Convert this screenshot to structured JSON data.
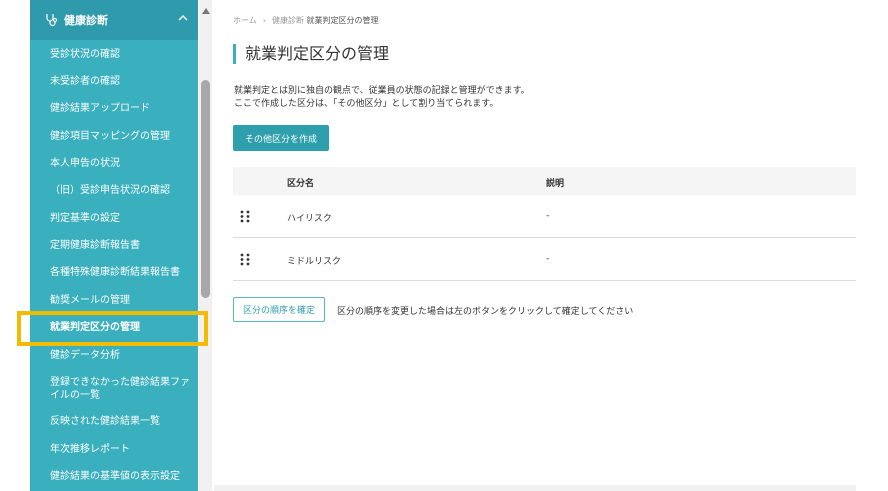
{
  "sidebar": {
    "section_title": "健康診断",
    "items": [
      {
        "label": "受診状況の確認"
      },
      {
        "label": "未受診者の確認"
      },
      {
        "label": "健診結果アップロード"
      },
      {
        "label": "健診項目マッピングの管理"
      },
      {
        "label": "本人申告の状況"
      },
      {
        "label": "（旧）受診申告状況の確認"
      },
      {
        "label": "判定基準の設定"
      },
      {
        "label": "定期健康診断報告書"
      },
      {
        "label": "各種特殊健康診断結果報告書"
      },
      {
        "label": "勧奨メールの管理"
      },
      {
        "label": "就業判定区分の管理"
      },
      {
        "label": "健診データ分析"
      },
      {
        "label": "登録できなかった健診結果ファイルの一覧"
      },
      {
        "label": "反映された健診結果一覧"
      },
      {
        "label": "年次推移レポート"
      },
      {
        "label": "健診結果の基準値の表示設定"
      }
    ],
    "active_index": 10
  },
  "breadcrumb": {
    "home": "ホーム",
    "parent": "健康診断",
    "current": "就業判定区分の管理"
  },
  "page": {
    "title": "就業判定区分の管理",
    "description_line1": "就業判定とは別に独自の観点で、従業員の状態の記録と管理ができます。",
    "description_line2": "ここで作成した区分は、「その他区分」として割り当てられます。",
    "create_button": "その他区分を作成"
  },
  "table": {
    "headers": {
      "name": "区分名",
      "description": "説明"
    },
    "rows": [
      {
        "name": "ハイリスク",
        "description": "-"
      },
      {
        "name": "ミドルリスク",
        "description": "-"
      }
    ]
  },
  "confirm": {
    "button": "区分の順序を確定",
    "note": "区分の順序を変更した場合は左のボタンをクリックして確定してください"
  },
  "colors": {
    "sidebar_bg": "#3aafbd",
    "accent": "#2e9fad",
    "highlight_box": "#f2bb00"
  },
  "icons": {
    "section": "stethoscope-icon",
    "collapse": "chevron-up-icon",
    "drag": "drag-handle-icon"
  }
}
